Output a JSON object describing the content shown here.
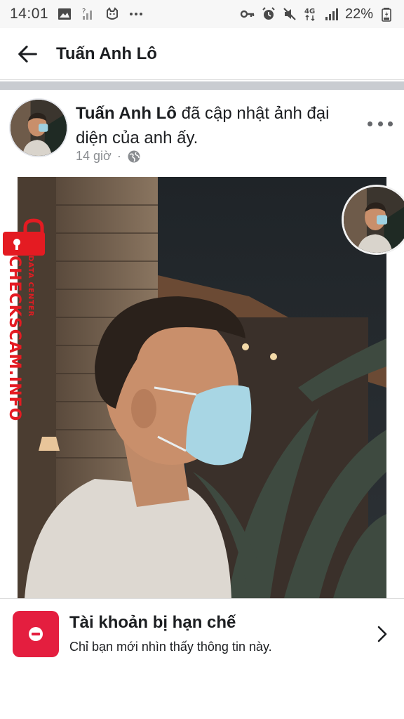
{
  "status_bar": {
    "time": "14:01",
    "battery": "22%",
    "icons_left": [
      "image-icon",
      "no-signal-icon",
      "cat-icon",
      "more-dots-icon"
    ],
    "icons_right": [
      "key-icon",
      "alarm-icon",
      "mute-icon",
      "4g-icon",
      "signal-icon",
      "battery-icon"
    ],
    "network_label": "4G"
  },
  "header": {
    "title": "Tuấn Anh Lô",
    "back_icon": "arrow-left-icon"
  },
  "post": {
    "author": "Tuấn Anh Lô",
    "action": " đã cập nhật ảnh đại diện của anh ấy.",
    "time": "14 giờ",
    "separator": "·",
    "audience_icon": "globe-icon",
    "more_icon": "more-horizontal-icon"
  },
  "watermark": {
    "brand": "CHECKSCAM.INFO",
    "sub": "DATA CENTER"
  },
  "notice": {
    "title": "Tài khoản bị hạn chế",
    "subtitle": "Chỉ bạn mới nhìn thấy thông tin này.",
    "icon": "restricted-icon",
    "color": "#e41e3f"
  }
}
